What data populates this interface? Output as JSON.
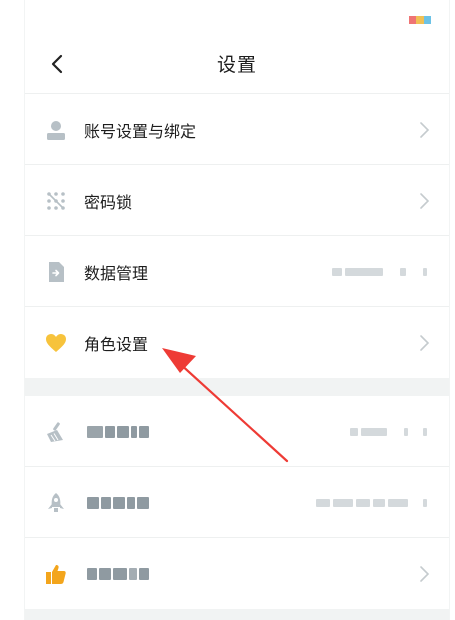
{
  "header": {
    "title": "设置",
    "back_icon": "chevron-left-icon"
  },
  "settings": [
    {
      "label": "账号设置与绑定",
      "icon": "user-icon"
    },
    {
      "label": "密码锁",
      "icon": "dots-grid-icon"
    },
    {
      "label": "数据管理",
      "icon": "document-icon"
    },
    {
      "label": "角色设置",
      "icon": "heart-icon"
    }
  ],
  "colors": {
    "accent_heart": "#f7c33c",
    "icon_gray": "#b7c0c6",
    "thumbs_up": "#f3a51c",
    "arrow_red": "#ee3b35",
    "status_bars": [
      "#ef7474",
      "#f0c055",
      "#6cc2e6"
    ]
  },
  "annotation": {
    "type": "red-arrow",
    "target": "角色设置"
  }
}
